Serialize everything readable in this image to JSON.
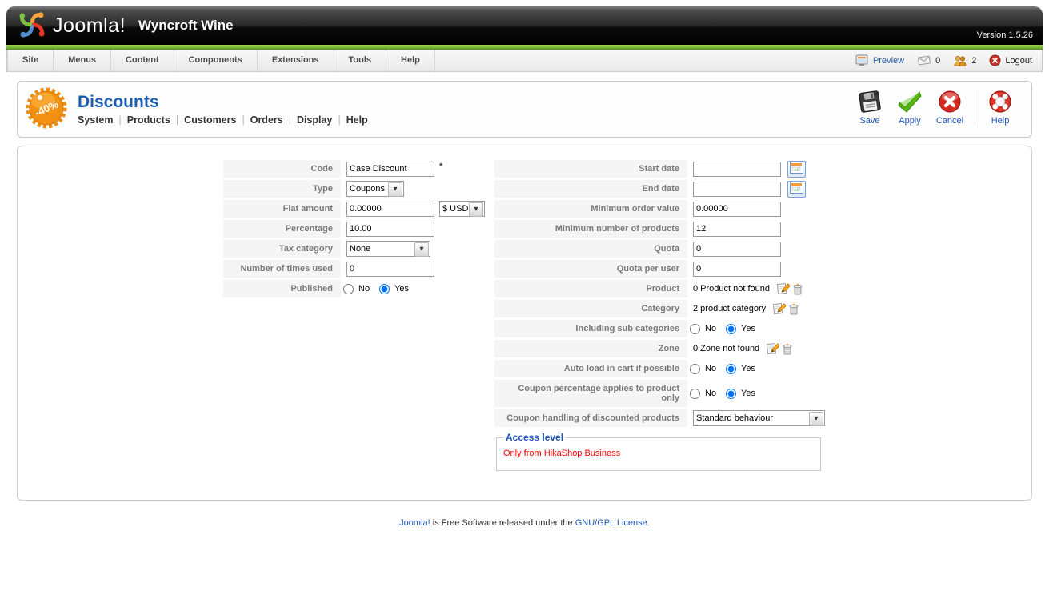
{
  "colors": {
    "accent_blue": "#1c5eb1",
    "toolbar_link_blue": "#1e55b5",
    "green_bar": "#7cb83a",
    "alert_red": "#ff0000",
    "badge_orange": "#f29111",
    "label_gray": "#7a7a7a"
  },
  "icons": {
    "logo": "joomla-knot",
    "preview": "monitor",
    "messages": "envelope",
    "online": "users",
    "logout": "red-power-circle",
    "page_badge": "discount-starburst",
    "save": "floppy-disk",
    "apply": "green-check",
    "cancel": "red-cross-circle",
    "help": "life-ring",
    "date": "calendar",
    "edit": "page-pencil",
    "delete": "trash-can",
    "select_arrow": "chevron-down"
  },
  "header": {
    "logo_text": "Joomla!",
    "site_title": "Wyncroft Wine",
    "version": "Version 1.5.26"
  },
  "menubar": {
    "items": [
      "Site",
      "Menus",
      "Content",
      "Components",
      "Extensions",
      "Tools",
      "Help"
    ],
    "preview_label": "Preview",
    "message_count": "0",
    "online_count": "2",
    "logout_label": "Logout"
  },
  "page": {
    "title": "Discounts",
    "badge_text": "-40%",
    "submenu": [
      "System",
      "Products",
      "Customers",
      "Orders",
      "Display",
      "Help"
    ]
  },
  "toolbar": {
    "save": "Save",
    "apply": "Apply",
    "cancel": "Cancel",
    "help": "Help"
  },
  "form": {
    "code": {
      "label": "Code",
      "value": "Case Discount",
      "required": "*"
    },
    "type": {
      "label": "Type",
      "value": "Coupons"
    },
    "flat_amount": {
      "label": "Flat amount",
      "value": "0.00000",
      "currency": "$ USD"
    },
    "percentage": {
      "label": "Percentage",
      "value": "10.00"
    },
    "tax_category": {
      "label": "Tax category",
      "value": "None"
    },
    "times_used": {
      "label": "Number of times used",
      "value": "0"
    },
    "published": {
      "label": "Published",
      "no": "No",
      "yes": "Yes",
      "selected": "Yes"
    },
    "start_date": {
      "label": "Start date",
      "value": ""
    },
    "end_date": {
      "label": "End date",
      "value": ""
    },
    "min_order_value": {
      "label": "Minimum order value",
      "value": "0.00000"
    },
    "min_products": {
      "label": "Minimum number of products",
      "value": "12"
    },
    "quota": {
      "label": "Quota",
      "value": "0"
    },
    "quota_per_user": {
      "label": "Quota per user",
      "value": "0"
    },
    "product": {
      "label": "Product",
      "value": "0 Product not found"
    },
    "category": {
      "label": "Category",
      "value": "2 product category"
    },
    "sub_categories": {
      "label": "Including sub categories",
      "no": "No",
      "yes": "Yes",
      "selected": "Yes"
    },
    "zone": {
      "label": "Zone",
      "value": "0 Zone not found"
    },
    "auto_load": {
      "label": "Auto load in cart if possible",
      "no": "No",
      "yes": "Yes",
      "selected": "Yes"
    },
    "coupon_percentage": {
      "label": "Coupon percentage applies to product only",
      "no": "No",
      "yes": "Yes",
      "selected": "Yes"
    },
    "coupon_handling": {
      "label": "Coupon handling of discounted products",
      "value": "Standard behaviour"
    },
    "access_level": {
      "legend": "Access level",
      "text": "Only from HikaShop Business"
    }
  },
  "footer": {
    "link1": "Joomla!",
    "middle": " is Free Software released under the ",
    "link2": "GNU/GPL License",
    "end": "."
  }
}
